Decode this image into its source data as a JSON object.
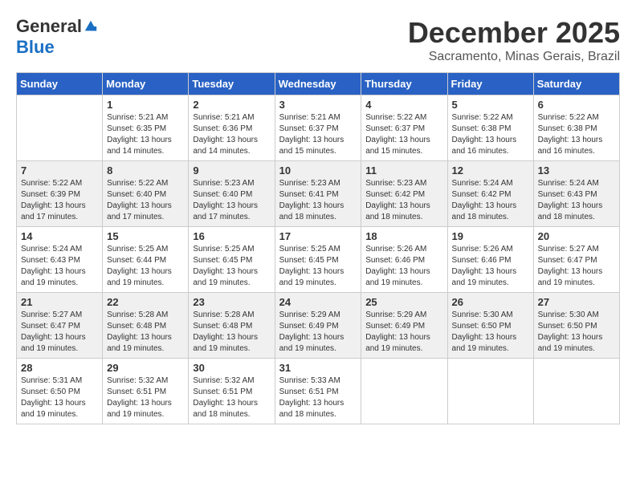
{
  "header": {
    "logo_general": "General",
    "logo_blue": "Blue",
    "month_title": "December 2025",
    "location": "Sacramento, Minas Gerais, Brazil"
  },
  "days_of_week": [
    "Sunday",
    "Monday",
    "Tuesday",
    "Wednesday",
    "Thursday",
    "Friday",
    "Saturday"
  ],
  "weeks": [
    [
      {
        "num": "",
        "sunrise": "",
        "sunset": "",
        "daylight": "",
        "empty": true
      },
      {
        "num": "1",
        "sunrise": "Sunrise: 5:21 AM",
        "sunset": "Sunset: 6:35 PM",
        "daylight": "Daylight: 13 hours and 14 minutes."
      },
      {
        "num": "2",
        "sunrise": "Sunrise: 5:21 AM",
        "sunset": "Sunset: 6:36 PM",
        "daylight": "Daylight: 13 hours and 14 minutes."
      },
      {
        "num": "3",
        "sunrise": "Sunrise: 5:21 AM",
        "sunset": "Sunset: 6:37 PM",
        "daylight": "Daylight: 13 hours and 15 minutes."
      },
      {
        "num": "4",
        "sunrise": "Sunrise: 5:22 AM",
        "sunset": "Sunset: 6:37 PM",
        "daylight": "Daylight: 13 hours and 15 minutes."
      },
      {
        "num": "5",
        "sunrise": "Sunrise: 5:22 AM",
        "sunset": "Sunset: 6:38 PM",
        "daylight": "Daylight: 13 hours and 16 minutes."
      },
      {
        "num": "6",
        "sunrise": "Sunrise: 5:22 AM",
        "sunset": "Sunset: 6:38 PM",
        "daylight": "Daylight: 13 hours and 16 minutes."
      }
    ],
    [
      {
        "num": "7",
        "sunrise": "Sunrise: 5:22 AM",
        "sunset": "Sunset: 6:39 PM",
        "daylight": "Daylight: 13 hours and 17 minutes."
      },
      {
        "num": "8",
        "sunrise": "Sunrise: 5:22 AM",
        "sunset": "Sunset: 6:40 PM",
        "daylight": "Daylight: 13 hours and 17 minutes."
      },
      {
        "num": "9",
        "sunrise": "Sunrise: 5:23 AM",
        "sunset": "Sunset: 6:40 PM",
        "daylight": "Daylight: 13 hours and 17 minutes."
      },
      {
        "num": "10",
        "sunrise": "Sunrise: 5:23 AM",
        "sunset": "Sunset: 6:41 PM",
        "daylight": "Daylight: 13 hours and 18 minutes."
      },
      {
        "num": "11",
        "sunrise": "Sunrise: 5:23 AM",
        "sunset": "Sunset: 6:42 PM",
        "daylight": "Daylight: 13 hours and 18 minutes."
      },
      {
        "num": "12",
        "sunrise": "Sunrise: 5:24 AM",
        "sunset": "Sunset: 6:42 PM",
        "daylight": "Daylight: 13 hours and 18 minutes."
      },
      {
        "num": "13",
        "sunrise": "Sunrise: 5:24 AM",
        "sunset": "Sunset: 6:43 PM",
        "daylight": "Daylight: 13 hours and 18 minutes."
      }
    ],
    [
      {
        "num": "14",
        "sunrise": "Sunrise: 5:24 AM",
        "sunset": "Sunset: 6:43 PM",
        "daylight": "Daylight: 13 hours and 19 minutes."
      },
      {
        "num": "15",
        "sunrise": "Sunrise: 5:25 AM",
        "sunset": "Sunset: 6:44 PM",
        "daylight": "Daylight: 13 hours and 19 minutes."
      },
      {
        "num": "16",
        "sunrise": "Sunrise: 5:25 AM",
        "sunset": "Sunset: 6:45 PM",
        "daylight": "Daylight: 13 hours and 19 minutes."
      },
      {
        "num": "17",
        "sunrise": "Sunrise: 5:25 AM",
        "sunset": "Sunset: 6:45 PM",
        "daylight": "Daylight: 13 hours and 19 minutes."
      },
      {
        "num": "18",
        "sunrise": "Sunrise: 5:26 AM",
        "sunset": "Sunset: 6:46 PM",
        "daylight": "Daylight: 13 hours and 19 minutes."
      },
      {
        "num": "19",
        "sunrise": "Sunrise: 5:26 AM",
        "sunset": "Sunset: 6:46 PM",
        "daylight": "Daylight: 13 hours and 19 minutes."
      },
      {
        "num": "20",
        "sunrise": "Sunrise: 5:27 AM",
        "sunset": "Sunset: 6:47 PM",
        "daylight": "Daylight: 13 hours and 19 minutes."
      }
    ],
    [
      {
        "num": "21",
        "sunrise": "Sunrise: 5:27 AM",
        "sunset": "Sunset: 6:47 PM",
        "daylight": "Daylight: 13 hours and 19 minutes."
      },
      {
        "num": "22",
        "sunrise": "Sunrise: 5:28 AM",
        "sunset": "Sunset: 6:48 PM",
        "daylight": "Daylight: 13 hours and 19 minutes."
      },
      {
        "num": "23",
        "sunrise": "Sunrise: 5:28 AM",
        "sunset": "Sunset: 6:48 PM",
        "daylight": "Daylight: 13 hours and 19 minutes."
      },
      {
        "num": "24",
        "sunrise": "Sunrise: 5:29 AM",
        "sunset": "Sunset: 6:49 PM",
        "daylight": "Daylight: 13 hours and 19 minutes."
      },
      {
        "num": "25",
        "sunrise": "Sunrise: 5:29 AM",
        "sunset": "Sunset: 6:49 PM",
        "daylight": "Daylight: 13 hours and 19 minutes."
      },
      {
        "num": "26",
        "sunrise": "Sunrise: 5:30 AM",
        "sunset": "Sunset: 6:50 PM",
        "daylight": "Daylight: 13 hours and 19 minutes."
      },
      {
        "num": "27",
        "sunrise": "Sunrise: 5:30 AM",
        "sunset": "Sunset: 6:50 PM",
        "daylight": "Daylight: 13 hours and 19 minutes."
      }
    ],
    [
      {
        "num": "28",
        "sunrise": "Sunrise: 5:31 AM",
        "sunset": "Sunset: 6:50 PM",
        "daylight": "Daylight: 13 hours and 19 minutes."
      },
      {
        "num": "29",
        "sunrise": "Sunrise: 5:32 AM",
        "sunset": "Sunset: 6:51 PM",
        "daylight": "Daylight: 13 hours and 19 minutes."
      },
      {
        "num": "30",
        "sunrise": "Sunrise: 5:32 AM",
        "sunset": "Sunset: 6:51 PM",
        "daylight": "Daylight: 13 hours and 18 minutes."
      },
      {
        "num": "31",
        "sunrise": "Sunrise: 5:33 AM",
        "sunset": "Sunset: 6:51 PM",
        "daylight": "Daylight: 13 hours and 18 minutes."
      },
      {
        "num": "",
        "sunrise": "",
        "sunset": "",
        "daylight": "",
        "empty": true
      },
      {
        "num": "",
        "sunrise": "",
        "sunset": "",
        "daylight": "",
        "empty": true
      },
      {
        "num": "",
        "sunrise": "",
        "sunset": "",
        "daylight": "",
        "empty": true
      }
    ]
  ]
}
